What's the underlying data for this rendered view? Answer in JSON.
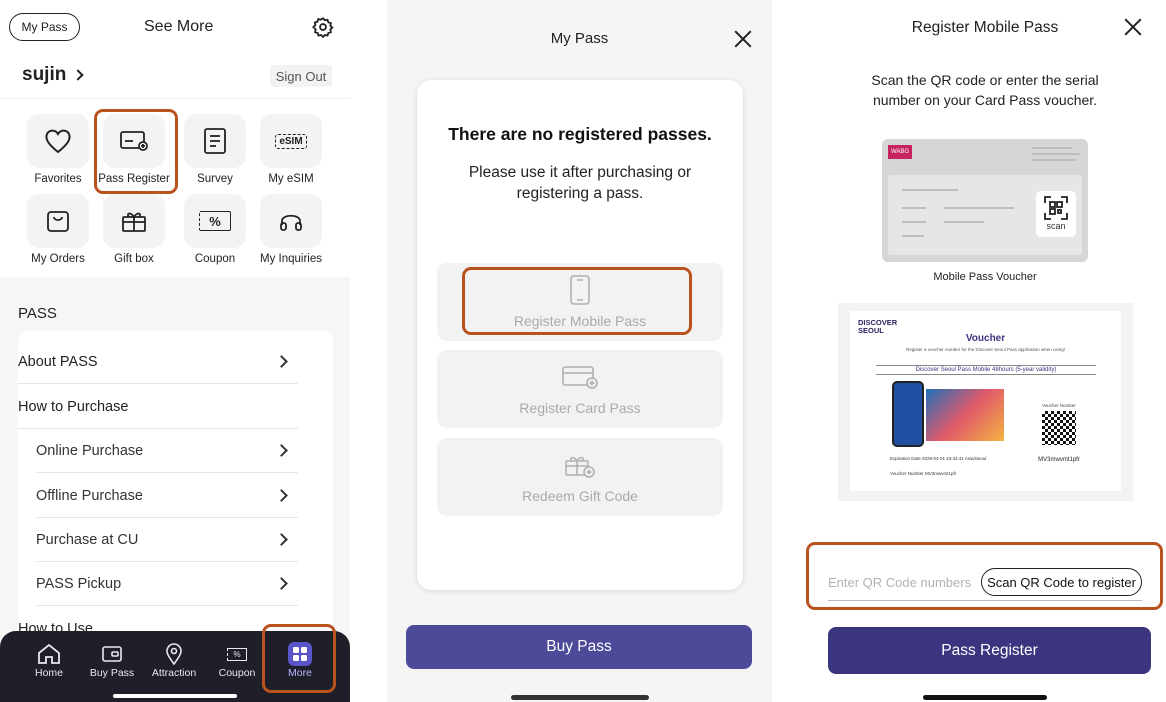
{
  "screen1": {
    "my_pass_button": "My Pass",
    "title": "See More",
    "username": "sujin",
    "sign_out": "Sign Out",
    "grid": [
      {
        "label": "Favorites",
        "icon": "heart-icon"
      },
      {
        "label": "Pass Register",
        "icon": "card-add-icon"
      },
      {
        "label": "Survey",
        "icon": "survey-icon"
      },
      {
        "label": "My eSIM",
        "icon": "esim-icon",
        "icon_text": "eSIM"
      },
      {
        "label": "My Orders",
        "icon": "bag-icon"
      },
      {
        "label": "Gift box",
        "icon": "gift-icon"
      },
      {
        "label": "Coupon",
        "icon": "coupon-icon",
        "icon_text": "%"
      },
      {
        "label": "My Inquiries",
        "icon": "headset-icon"
      }
    ],
    "section_title": "PASS",
    "menu": [
      {
        "label": "About PASS",
        "chevron": true
      },
      {
        "label": "How to Purchase",
        "chevron": false
      },
      {
        "label": "Online Purchase",
        "chevron": true,
        "sub": true
      },
      {
        "label": "Offline Purchase",
        "chevron": true,
        "sub": true
      },
      {
        "label": "Purchase at CU",
        "chevron": true,
        "sub": true
      },
      {
        "label": "PASS Pickup",
        "chevron": true,
        "sub": true
      },
      {
        "label": "How to Use",
        "chevron": false
      }
    ],
    "tabs": [
      {
        "label": "Home",
        "icon": "home-icon"
      },
      {
        "label": "Buy Pass",
        "icon": "wallet-icon"
      },
      {
        "label": "Attraction",
        "icon": "pin-icon"
      },
      {
        "label": "Coupon",
        "icon": "coupon-icon",
        "icon_text": "%"
      },
      {
        "label": "More",
        "icon": "more-grid-icon",
        "active": true
      }
    ]
  },
  "screen2": {
    "title": "My Pass",
    "empty_title": "There are no registered passes.",
    "empty_text": "Please use it after purchasing or registering a pass.",
    "options": [
      {
        "label": "Register Mobile Pass",
        "icon": "phone-icon"
      },
      {
        "label": "Register Card Pass",
        "icon": "card-add-icon"
      },
      {
        "label": "Redeem Gift Code",
        "icon": "gift-add-icon"
      }
    ],
    "buy_button": "Buy Pass"
  },
  "screen3": {
    "title": "Register Mobile Pass",
    "description": "Scan the QR code or enter the serial number on your Card Pass voucher.",
    "voucher1_caption": "Mobile Pass Voucher",
    "voucher1_logo": "WABG",
    "scan_label": "scan",
    "voucher2": {
      "brand_line1": "DISCOVER",
      "brand_line2": "SEOUL",
      "title": "Voucher",
      "subtitle": "Register a voucher number for the Discover Seoul Pass application when using!",
      "product": "Discover Seoul Pass Mobile 48hours (5-year validity)",
      "voucher_number_label": "Voucher Number",
      "code": "MV3mwvmt1pfr",
      "expiration": "Expiration Date   2029-04-01 23:34:41 Asia/Seoul",
      "voucher_number_row": "Voucher Number   MV3mwvmt1pfr"
    },
    "input_placeholder": "Enter QR Code numbers",
    "scan_button": "Scan QR Code to register",
    "register_button": "Pass Register"
  },
  "colors": {
    "highlight": "#b8531d",
    "primary_button": "#4d4a99",
    "register_button": "#3b3580",
    "tabbar": "#1f1f2a",
    "active_tab": "#5a55c8"
  }
}
